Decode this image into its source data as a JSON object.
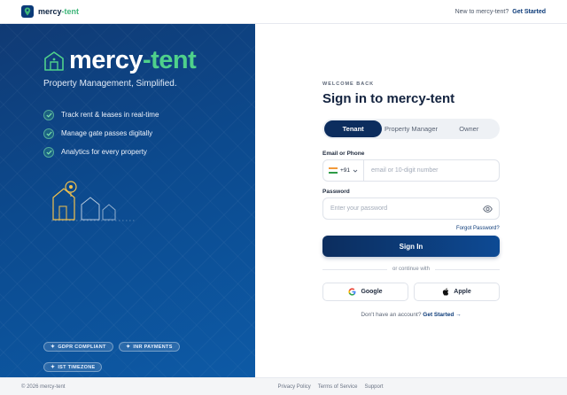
{
  "topbar": {
    "brand_main": "mercy",
    "brand_accent": "-tent",
    "question": "New to mercy-tent?",
    "cta": "Get Started"
  },
  "hero": {
    "brand_main": "mercy",
    "brand_accent": "-tent",
    "tagline": "Property Management, Simplified.",
    "features": [
      "Track rent & leases in real-time",
      "Manage gate passes digitally",
      "Analytics for every property"
    ],
    "badges": [
      "GDPR COMPLIANT",
      "INR PAYMENTS",
      "IST TIMEZONE"
    ],
    "badge_icon": "✦"
  },
  "form": {
    "eyebrow": "WELCOME BACK",
    "title": "Sign in to mercy-tent",
    "roles": [
      "Tenant",
      "Property Manager",
      "Owner"
    ],
    "active_role": "Tenant",
    "email_label": "Email or Phone",
    "country_code": "+91",
    "email_placeholder": "email or 10-digit number",
    "password_label": "Password",
    "password_placeholder": "Enter your password",
    "forgot": "Forgot Password?",
    "submit": "Sign In",
    "divider": "or continue with",
    "google": "Google",
    "apple": "Apple",
    "signup_prompt": "Don't have an account?",
    "signup_link": "Get Started →"
  },
  "footer": {
    "copyright": "© 2026 mercy-tent",
    "links": [
      "Privacy Policy",
      "Terms of Service",
      "Support"
    ]
  },
  "colors": {
    "brand_navy": "#0c2d5e",
    "accent_green": "#3fb67a",
    "hero_blue": "#0c4a8e"
  },
  "icons": {
    "logo": "home-pin-icon",
    "check": "check-icon",
    "eye": "eye-icon",
    "caret": "chevron-down-icon",
    "google": "google-icon",
    "apple": "apple-icon"
  }
}
